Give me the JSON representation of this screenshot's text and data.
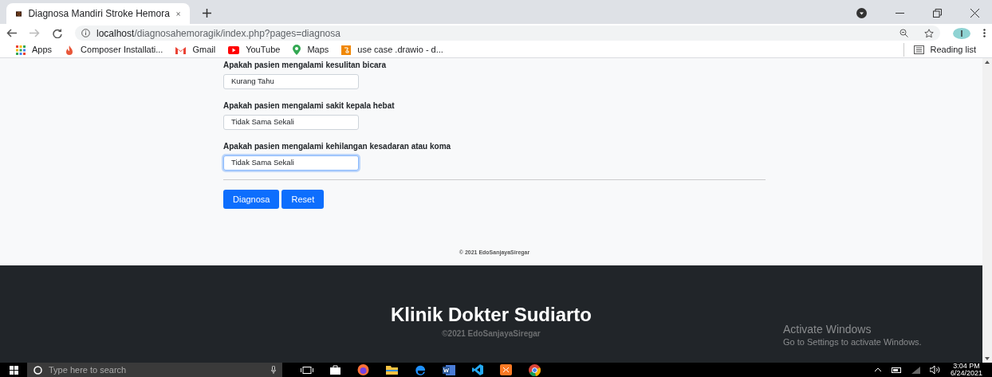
{
  "browser": {
    "tab_title": "Diagnosa Mandiri Stroke Hemora",
    "url_host": "localhost",
    "url_path": "/diagnosahemoragik/index.php?pages=diagnosa",
    "bookmarks": [
      {
        "label": "Apps",
        "kind": "apps"
      },
      {
        "label": "Composer Installati...",
        "kind": "composer"
      },
      {
        "label": "Gmail",
        "kind": "gmail"
      },
      {
        "label": "YouTube",
        "kind": "youtube"
      },
      {
        "label": "Maps",
        "kind": "maps"
      },
      {
        "label": "use case .drawio - d...",
        "kind": "drawio"
      }
    ],
    "reading_list": "Reading list"
  },
  "form": {
    "questions": [
      {
        "label": "Apakah pasien mengalami kesulitan bicara",
        "value": "Kurang Tahu",
        "focused": false
      },
      {
        "label": "Apakah pasien mengalami sakit kepala hebat",
        "value": "Tidak Sama Sekali",
        "focused": false
      },
      {
        "label": "Apakah pasien mengalami kehilangan kesadaran atau koma",
        "value": "Tidak Sama Sekali",
        "focused": true
      }
    ],
    "buttons": [
      "Diagnosa",
      "Reset"
    ],
    "copyright": "© 2021 EdoSanjayaSiregar"
  },
  "footer": {
    "title": "Klinik Dokter Sudiarto",
    "subtitle": "©2021 EdoSanjayaSiregar"
  },
  "activation": {
    "title": "Activate Windows",
    "text": "Go to Settings to activate Windows."
  },
  "taskbar": {
    "search_placeholder": "Type here to search",
    "time": "3:04 PM",
    "date": "6/24/2021"
  }
}
